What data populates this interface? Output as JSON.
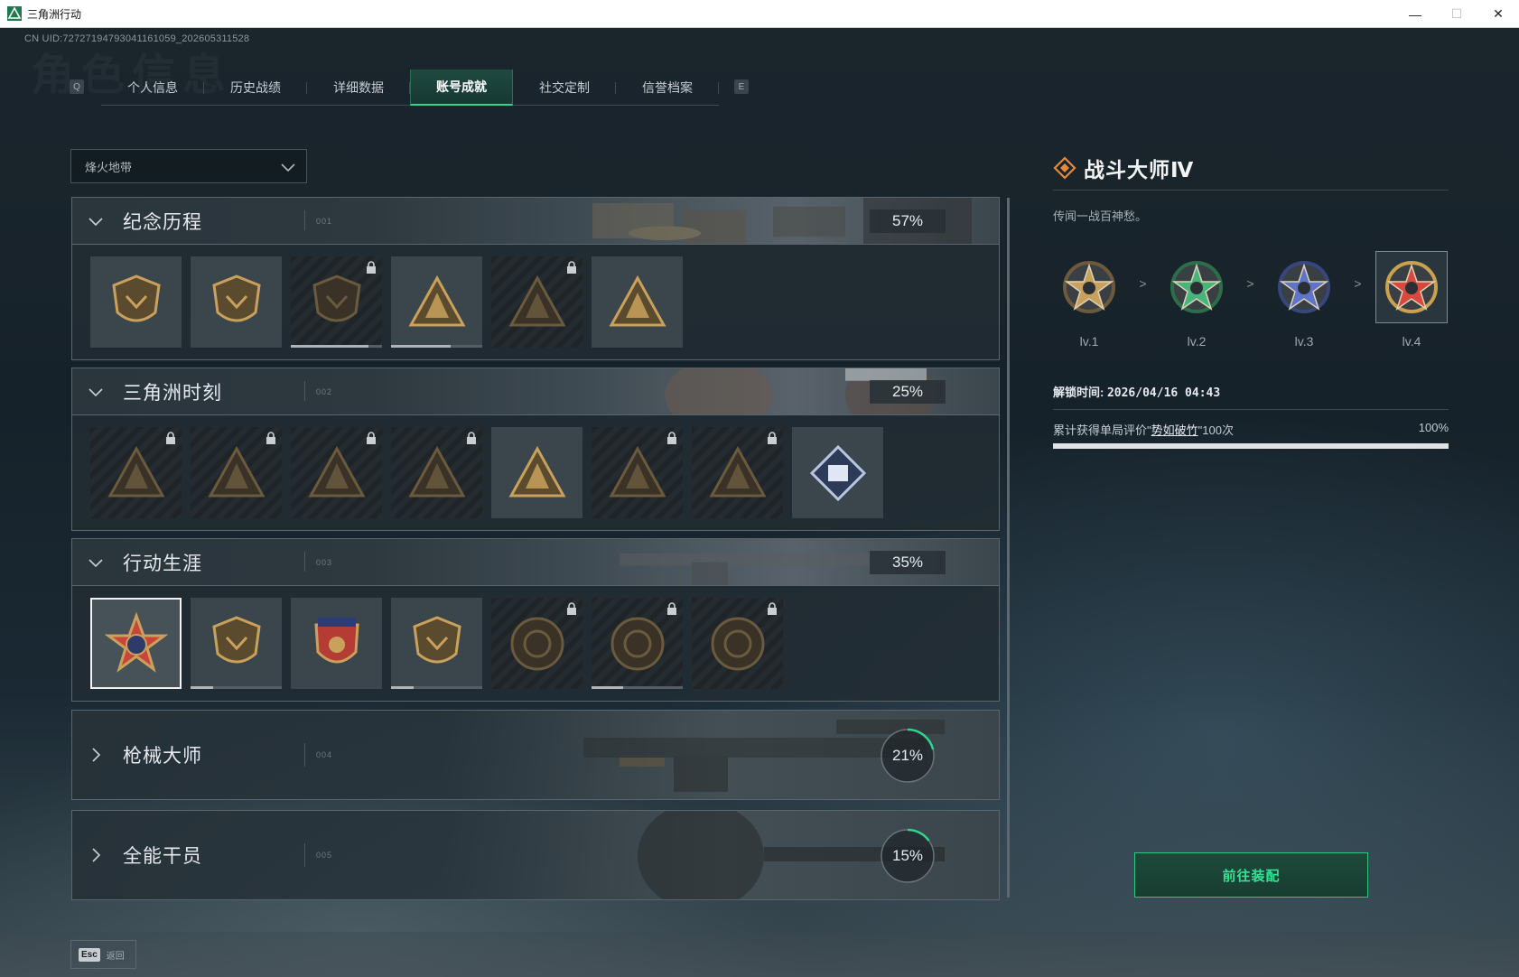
{
  "window": {
    "title": "三角洲行动",
    "minimize": "—",
    "maximize": "☐",
    "close": "✕"
  },
  "uid": "CN UID:727271947930411610​59_202605311528",
  "watermark": "角色信息",
  "tabs": {
    "left_key": "Q",
    "right_key": "E",
    "items": [
      {
        "label": "个人信息",
        "active": false
      },
      {
        "label": "历史战绩",
        "active": false
      },
      {
        "label": "详细数据",
        "active": false
      },
      {
        "label": "账号成就",
        "active": true
      },
      {
        "label": "社交定制",
        "active": false
      },
      {
        "label": "信誉档案",
        "active": false
      }
    ]
  },
  "mode_select": {
    "value": "烽火地带"
  },
  "categories": [
    {
      "name": "纪念历程",
      "num": "001",
      "percent": "57%",
      "expanded": true,
      "badges": [
        {
          "icon": "triangle-shield-medal-icon",
          "locked": false,
          "progress": null
        },
        {
          "icon": "helicopter-medal-icon",
          "locked": false,
          "progress": null
        },
        {
          "icon": "hex-shield-medal-icon",
          "locked": true,
          "progress": 0.85
        },
        {
          "icon": "s9-winged-medal-icon",
          "locked": false,
          "progress": 0.65
        },
        {
          "icon": "hooded-figure-medal-icon",
          "locked": true,
          "progress": null
        },
        {
          "icon": "skull-triangle-medal-icon",
          "locked": false,
          "progress": null
        }
      ]
    },
    {
      "name": "三角洲时刻",
      "num": "002",
      "percent": "25%",
      "expanded": true,
      "badges": [
        {
          "icon": "robot-triangle-medal-icon",
          "locked": true,
          "progress": null
        },
        {
          "icon": "mask-triangle-medal-icon",
          "locked": true,
          "progress": null
        },
        {
          "icon": "soldier-triangle-medal-icon",
          "locked": true,
          "progress": null
        },
        {
          "icon": "dice-triangle-medal-icon",
          "locked": true,
          "progress": null
        },
        {
          "icon": "runner-triangle-medal-icon",
          "locked": false,
          "progress": null
        },
        {
          "icon": "team-triangle-medal-icon",
          "locked": true,
          "progress": null
        },
        {
          "icon": "fish-triangle-medal-icon",
          "locked": true,
          "progress": null
        },
        {
          "icon": "diamond-book-medal-icon",
          "locked": false,
          "progress": null
        }
      ]
    },
    {
      "name": "行动生涯",
      "num": "003",
      "percent": "35%",
      "expanded": true,
      "badges": [
        {
          "icon": "star-rank-medal-icon",
          "locked": false,
          "selected": true,
          "progress": null
        },
        {
          "icon": "chevron-shield-medal-icon",
          "locked": false,
          "progress": 0.25
        },
        {
          "icon": "crest-stars-medal-icon",
          "locked": false,
          "progress": null
        },
        {
          "icon": "gem-shield-medal-icon",
          "locked": false,
          "progress": 0.25
        },
        {
          "icon": "orb-circle-medal-icon",
          "locked": true,
          "progress": null
        },
        {
          "icon": "skull-circle-medal-icon",
          "locked": true,
          "progress": 0.35
        },
        {
          "icon": "eye-circle-medal-icon",
          "locked": true,
          "progress": null
        }
      ]
    },
    {
      "name": "枪械大师",
      "num": "004",
      "percent": "21%",
      "progress": 0.21,
      "expanded": false
    },
    {
      "name": "全能干员",
      "num": "005",
      "percent": "15%",
      "progress": 0.15,
      "expanded": false
    }
  ],
  "detail": {
    "title": "战斗大师Ⅳ",
    "description": "传闻一战百神愁。",
    "levels": [
      {
        "label": "lv.1",
        "color": "#c9a15c",
        "ring": "#6d5a3c"
      },
      {
        "label": "lv.2",
        "color": "#47b57a",
        "ring": "#2c6e4a"
      },
      {
        "label": "lv.3",
        "color": "#5d74c8",
        "ring": "#37467d"
      },
      {
        "label": "lv.4",
        "color": "#d9483c",
        "ring": "#caa14f"
      }
    ],
    "level_arrow": ">",
    "unlock_label": "解锁时间: ",
    "unlock_time": "2026/04/16 04:43",
    "condition_prefix": "累计获得单局评价\"",
    "condition_link": "势如破竹",
    "condition_suffix": "\"100次",
    "condition_percent": "100%",
    "condition_progress": 1.0
  },
  "equip_button": "前往装配",
  "esc": {
    "key": "Esc",
    "label": "返回"
  },
  "colors": {
    "accent": "#2fd58c",
    "gold": "#c9a15c"
  }
}
